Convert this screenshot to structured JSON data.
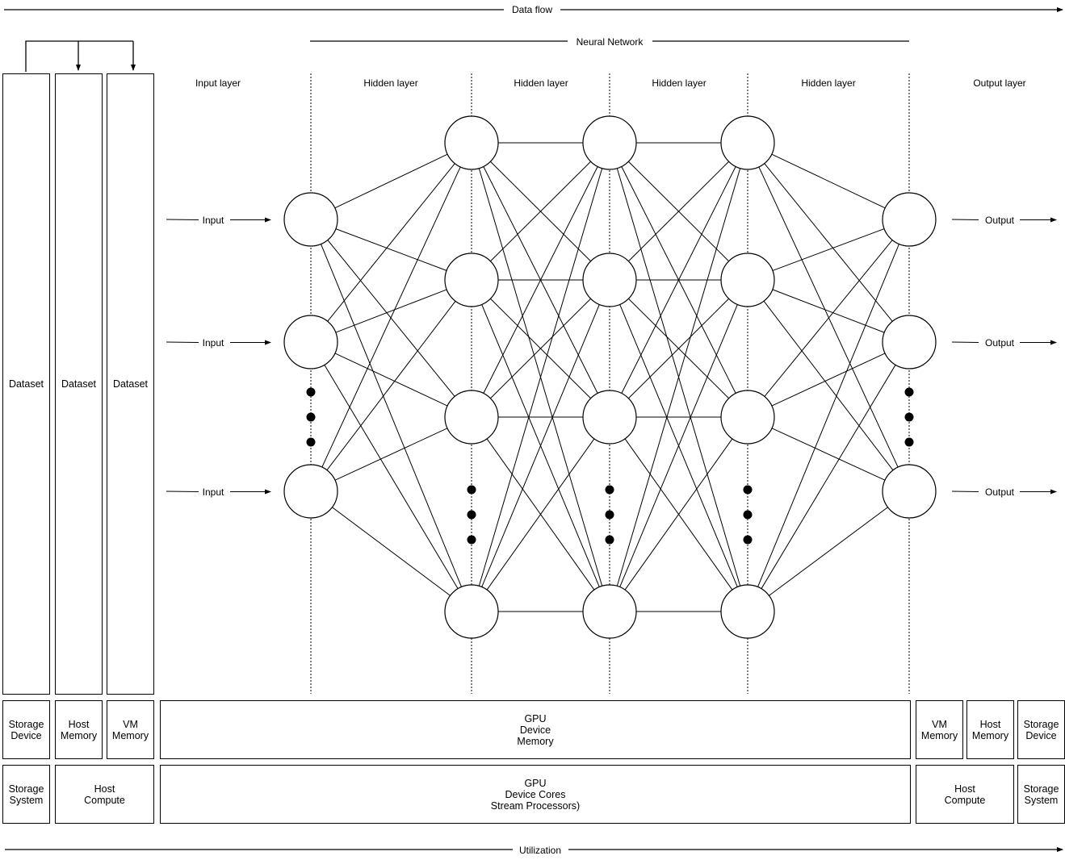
{
  "header": {
    "data_flow_label": "Data flow",
    "neural_network_label": "Neural Network",
    "utilization_label": "Utilization"
  },
  "layers": [
    {
      "label": "Input layer"
    },
    {
      "label": "Hidden layer"
    },
    {
      "label": "Hidden layer"
    },
    {
      "label": "Hidden layer"
    },
    {
      "label": "Hidden layer"
    },
    {
      "label": "Output layer"
    }
  ],
  "inputs": [
    "Input",
    "Input",
    "Input"
  ],
  "outputs": [
    "Output",
    "Output",
    "Output"
  ],
  "network": {
    "input_nodes": 3,
    "hidden_layers": 3,
    "hidden_nodes_per_layer": 4,
    "output_nodes": 3,
    "ellipsis_symbol": "•••"
  },
  "datasets": [
    "Dataset",
    "Dataset",
    "Dataset"
  ],
  "left_memory": [
    "Storage\nDevice",
    "Host\nMemory",
    "VM\nMemory"
  ],
  "left_compute": [
    "Storage\nSystem",
    "Host\nCompute"
  ],
  "gpu_memory": "GPU\nDevice\nMemory",
  "gpu_compute": "GPU\nDevice Cores\nStream Processors)",
  "right_memory": [
    "VM\nMemory",
    "Host\nMemory",
    "Storage\nDevice"
  ],
  "right_compute": [
    "Host\nCompute",
    "Storage\nSystem"
  ],
  "colors": {
    "line": "#000000",
    "background": "#ffffff"
  }
}
